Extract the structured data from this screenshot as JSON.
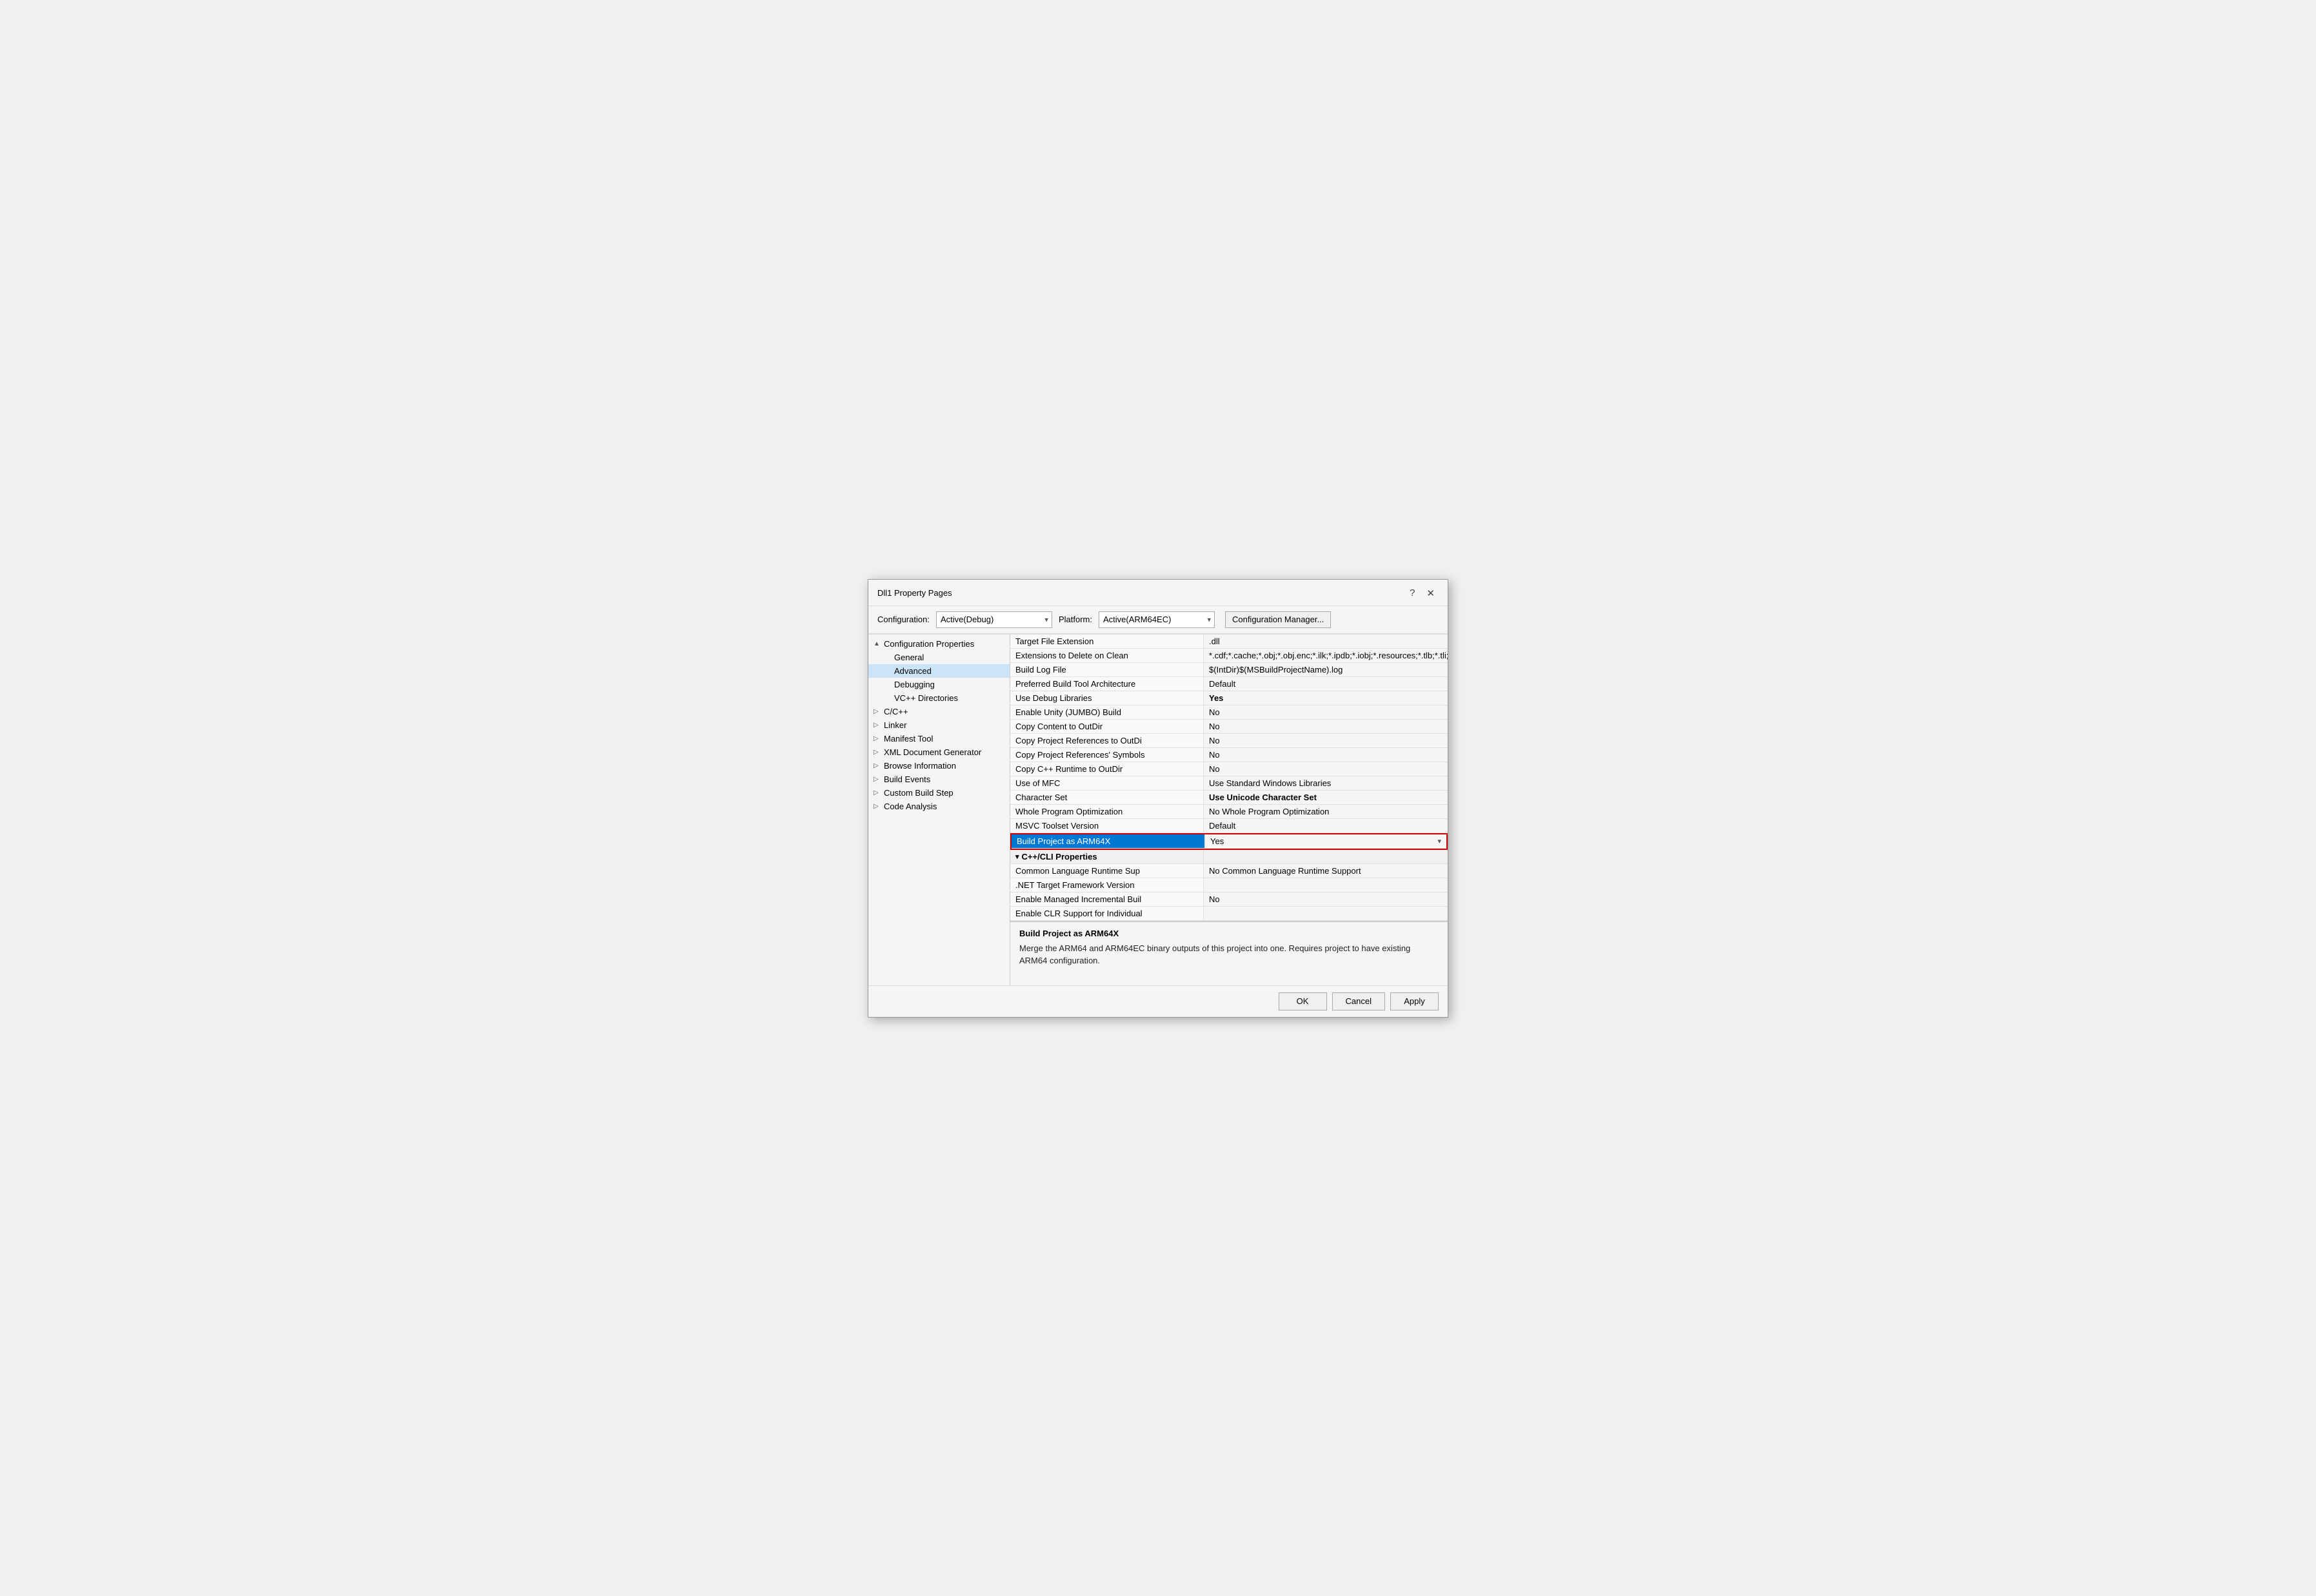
{
  "dialog": {
    "title": "Dll1 Property Pages",
    "help_btn": "?",
    "close_btn": "✕"
  },
  "config_bar": {
    "config_label": "Configuration:",
    "config_value": "Active(Debug)",
    "platform_label": "Platform:",
    "platform_value": "Active(ARM64EC)",
    "manager_btn": "Configuration Manager..."
  },
  "tree": {
    "items": [
      {
        "label": "Configuration Properties",
        "level": 0,
        "expand": "▲",
        "selected": false
      },
      {
        "label": "General",
        "level": 1,
        "expand": "",
        "selected": false
      },
      {
        "label": "Advanced",
        "level": 1,
        "expand": "",
        "selected": true
      },
      {
        "label": "Debugging",
        "level": 1,
        "expand": "",
        "selected": false
      },
      {
        "label": "VC++ Directories",
        "level": 1,
        "expand": "",
        "selected": false
      },
      {
        "label": "C/C++",
        "level": 0,
        "expand": "▷",
        "selected": false
      },
      {
        "label": "Linker",
        "level": 0,
        "expand": "▷",
        "selected": false
      },
      {
        "label": "Manifest Tool",
        "level": 0,
        "expand": "▷",
        "selected": false
      },
      {
        "label": "XML Document Generator",
        "level": 0,
        "expand": "▷",
        "selected": false
      },
      {
        "label": "Browse Information",
        "level": 0,
        "expand": "▷",
        "selected": false
      },
      {
        "label": "Build Events",
        "level": 0,
        "expand": "▷",
        "selected": false
      },
      {
        "label": "Custom Build Step",
        "level": 0,
        "expand": "▷",
        "selected": false
      },
      {
        "label": "Code Analysis",
        "level": 0,
        "expand": "▷",
        "selected": false
      }
    ]
  },
  "properties": [
    {
      "name": "Target File Extension",
      "value": ".dll",
      "bold": false
    },
    {
      "name": "Extensions to Delete on Clean",
      "value": "*.cdf;*.cache;*.obj;*.obj.enc;*.ilk;*.ipdb;*.iobj;*.resources;*.tlb;*.tli;*.t",
      "bold": false
    },
    {
      "name": "Build Log File",
      "value": "$(IntDir)$(MSBuildProjectName).log",
      "bold": false
    },
    {
      "name": "Preferred Build Tool Architecture",
      "value": "Default",
      "bold": false
    },
    {
      "name": "Use Debug Libraries",
      "value": "Yes",
      "bold": true
    },
    {
      "name": "Enable Unity (JUMBO) Build",
      "value": "No",
      "bold": false
    },
    {
      "name": "Copy Content to OutDir",
      "value": "No",
      "bold": false
    },
    {
      "name": "Copy Project References to OutDi",
      "value": "No",
      "bold": false
    },
    {
      "name": "Copy Project References' Symbols",
      "value": "No",
      "bold": false
    },
    {
      "name": "Copy C++ Runtime to OutDir",
      "value": "No",
      "bold": false
    },
    {
      "name": "Use of MFC",
      "value": "Use Standard Windows Libraries",
      "bold": false
    },
    {
      "name": "Character Set",
      "value": "Use Unicode Character Set",
      "bold": true
    },
    {
      "name": "Whole Program Optimization",
      "value": "No Whole Program Optimization",
      "bold": false
    },
    {
      "name": "MSVC Toolset Version",
      "value": "Default",
      "bold": false,
      "partial": true
    },
    {
      "name": "Build Project as ARM64X",
      "value": "Yes",
      "bold": false,
      "highlighted": true,
      "has_dropdown": true
    },
    {
      "name": "C++/CLI Properties",
      "value": "",
      "bold": false,
      "section": true
    },
    {
      "name": "Common Language Runtime Sup",
      "value": "No Common Language Runtime Support",
      "bold": false
    },
    {
      "name": ".NET Target Framework Version",
      "value": "",
      "bold": false
    },
    {
      "name": "Enable Managed Incremental Buil",
      "value": "No",
      "bold": false
    },
    {
      "name": "Enable CLR Support for Individual",
      "value": "",
      "bold": false
    }
  ],
  "description": {
    "title": "Build Project as ARM64X",
    "text": "Merge the ARM64 and ARM64EC binary outputs of this project into one. Requires project to have existing ARM64 configuration."
  },
  "buttons": {
    "ok": "OK",
    "cancel": "Cancel",
    "apply": "Apply"
  }
}
